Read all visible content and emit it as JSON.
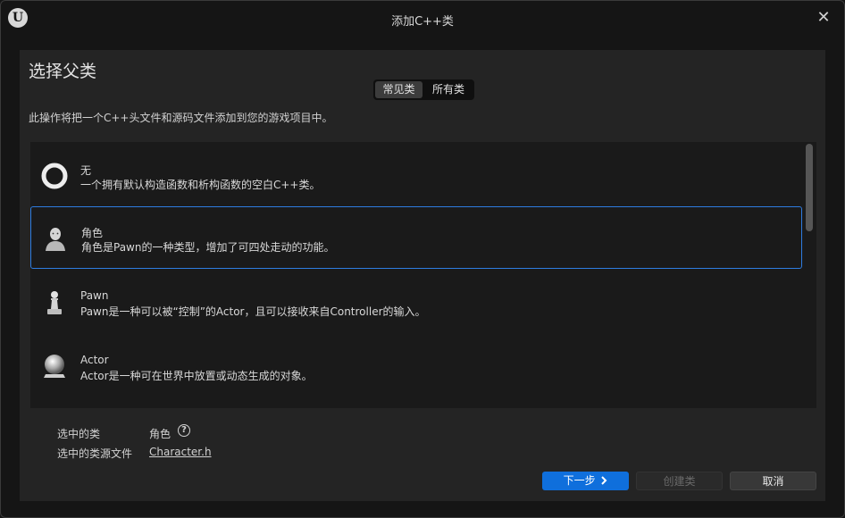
{
  "window": {
    "title": "添加C++类",
    "logo_text": "U"
  },
  "panel": {
    "heading": "选择父类",
    "tabs": [
      {
        "label": "常见类",
        "active": true
      },
      {
        "label": "所有类",
        "active": false
      }
    ],
    "description": "此操作将把一个C++头文件和源码文件添加到您的游戏项目中。"
  },
  "class_list": {
    "items": [
      {
        "name": "无",
        "desc": "一个拥有默认构造函数和析构函数的空白C++类。",
        "icon": "ring-icon",
        "selected": false
      },
      {
        "name": "角色",
        "desc": "角色是Pawn的一种类型，增加了可四处走动的功能。",
        "icon": "character-icon",
        "selected": true
      },
      {
        "name": "Pawn",
        "desc": "Pawn是一种可以被“控制”的Actor，且可以接收来自Controller的输入。",
        "icon": "pawn-icon",
        "selected": false
      },
      {
        "name": "Actor",
        "desc": "Actor是一种可在世界中放置或动态生成的对象。",
        "icon": "actor-sphere-icon",
        "selected": false
      }
    ]
  },
  "selection_info": {
    "class_label": "选中的类",
    "class_value": "角色",
    "source_label": "选中的类源文件",
    "source_value": "Character.h"
  },
  "footer": {
    "next_label": "下一步",
    "next_icon": "chevron-right-icon",
    "create_label": "创建类",
    "cancel_label": "取消"
  },
  "colors": {
    "accent": "#0f6fdc",
    "selection_border": "#2e7ce0",
    "background": "#151515",
    "panel": "#242424"
  }
}
